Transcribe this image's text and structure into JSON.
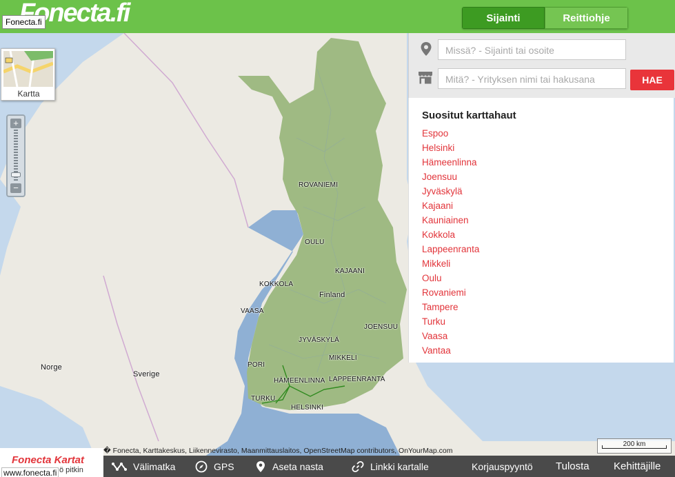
{
  "header": {
    "logo": "Fonecta.fi",
    "logo_tooltip": "Fonecta.fi",
    "tabs": [
      {
        "label": "Sijainti",
        "active": true
      },
      {
        "label": "Reittiohje",
        "active": false
      }
    ]
  },
  "layer_switch": {
    "label": "Kartta"
  },
  "zoom": {
    "in": "+",
    "out": "−"
  },
  "search": {
    "where_placeholder": "Missä? - Sijainti tai osoite",
    "what_placeholder": "Mitä? - Yrityksen nimi tai hakusana",
    "button": "HAE"
  },
  "popular": {
    "title": "Suositut karttahaut",
    "items": [
      "Espoo",
      "Helsinki",
      "Hämeenlinna",
      "Joensuu",
      "Jyväskylä",
      "Kajaani",
      "Kauniainen",
      "Kokkola",
      "Lappeenranta",
      "Mikkeli",
      "Oulu",
      "Rovaniemi",
      "Tampere",
      "Turku",
      "Vaasa",
      "Vantaa"
    ]
  },
  "map": {
    "labels": {
      "rovaniemi": "ROVANIEMI",
      "oulu": "OULU",
      "kajaani": "KAJAANI",
      "kokkola": "KOKKOLA",
      "finland": "Finland",
      "vaasa": "VAASA",
      "joensuu": "JOENSUU",
      "jyvaskyla": "JYVÄSKYLÄ",
      "mikkeli": "MIKKELI",
      "pori": "PORI",
      "hameenlinna": "HÄMEENLINNA",
      "lappeenranta": "LAPPEENRANTA",
      "turku": "TURKU",
      "helsinki": "HELSINKI",
      "norge": "Norge",
      "sverige": "Sverige"
    },
    "scale": "200 km",
    "attribution": "� Fonecta, Karttakeskus, Liikennevirasto, Maanmittauslaitos, OpenStreetMap contributors, OnYourMap.com"
  },
  "brand": {
    "name": "Fonecta Kartat",
    "url": "www.fonecta.fi",
    "partial": "ö pitkin"
  },
  "bottom_bar": {
    "valimatka": "Välimatka",
    "gps": "GPS",
    "aseta_nasta": "Aseta nasta",
    "linkki": "Linkki kartalle",
    "korjaus": "Korjauspyyntö",
    "tulosta": "Tulosta",
    "kehittajille": "Kehittäjille"
  },
  "colors": {
    "header_green": "#6cc24a",
    "active_tab": "#3d9b22",
    "accent_red": "#e9343a",
    "sea": "#c4d8ec",
    "land_finland": "#9fba83"
  }
}
